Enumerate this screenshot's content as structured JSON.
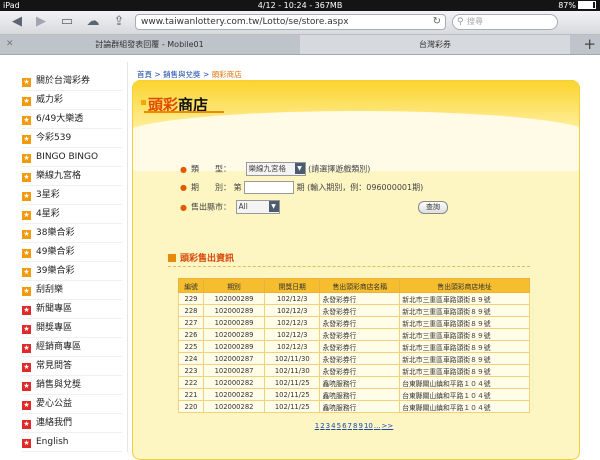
{
  "status": {
    "device": "iPad",
    "time": "4/12 - 10:24 - 367MB",
    "battery": "87%"
  },
  "browser": {
    "url": "www.taiwanlottery.com.tw/Lotto/se/store.aspx",
    "search_placeholder": "搜尋",
    "tabs": [
      "討論群組發表回覆 - Mobile01",
      "台灣彩券"
    ]
  },
  "sidebar": {
    "items": [
      {
        "label": "關於台灣彩券",
        "color": "orange"
      },
      {
        "label": "威力彩",
        "color": "orange"
      },
      {
        "label": "6/49大樂透",
        "color": "orange"
      },
      {
        "label": "今彩539",
        "color": "orange"
      },
      {
        "label": "BINGO BINGO",
        "color": "orange"
      },
      {
        "label": "樂線九宮格",
        "color": "orange"
      },
      {
        "label": "3星彩",
        "color": "orange"
      },
      {
        "label": "4星彩",
        "color": "orange"
      },
      {
        "label": "38樂合彩",
        "color": "orange"
      },
      {
        "label": "49樂合彩",
        "color": "orange"
      },
      {
        "label": "39樂合彩",
        "color": "orange"
      },
      {
        "label": "刮刮樂",
        "color": "orange"
      },
      {
        "label": "新聞專區",
        "color": "red"
      },
      {
        "label": "開獎專區",
        "color": "red"
      },
      {
        "label": "經銷商專區",
        "color": "red"
      },
      {
        "label": "常見問答",
        "color": "red"
      },
      {
        "label": "銷售與兌獎",
        "color": "red"
      },
      {
        "label": "愛心公益",
        "color": "red"
      },
      {
        "label": "連絡我們",
        "color": "red"
      },
      {
        "label": "English",
        "color": "red"
      }
    ]
  },
  "breadcrumb": {
    "home": "首頁",
    "sep": " > ",
    "parent": "銷售與兌獎",
    "current": "頭彩商店"
  },
  "page": {
    "title_highlight": "頭彩",
    "title_rest": "商店"
  },
  "form": {
    "type_label": "類　　型：",
    "type_value": "樂線九宮格",
    "type_hint": "(請選擇遊戲類別)",
    "period_label": "期　　別：",
    "period_prefix": "第",
    "period_suffix": "期 (輸入期別，例：096000001期)",
    "city_label": "售出縣市：",
    "city_value": "All",
    "query_button": "查詢"
  },
  "section": {
    "title": "頭彩售出資訊"
  },
  "table": {
    "headers": [
      "編號",
      "期別",
      "開獎日期",
      "售出頭彩商店名稱",
      "售出頭彩商店地址"
    ],
    "rows": [
      [
        "229",
        "102000289",
        "102/12/3",
        "永發彩券行",
        "新北市三重區車路頭街８９號"
      ],
      [
        "228",
        "102000289",
        "102/12/3",
        "永發彩券行",
        "新北市三重區車路頭街８９號"
      ],
      [
        "227",
        "102000289",
        "102/12/3",
        "永發彩券行",
        "新北市三重區車路頭街８９號"
      ],
      [
        "226",
        "102000289",
        "102/12/3",
        "永發彩券行",
        "新北市三重區車路頭街８９號"
      ],
      [
        "225",
        "102000289",
        "102/12/3",
        "永發彩券行",
        "新北市三重區車路頭街８９號"
      ],
      [
        "224",
        "102000287",
        "102/11/30",
        "永發彩券行",
        "新北市三重區車路頭街８９號"
      ],
      [
        "223",
        "102000287",
        "102/11/30",
        "永發彩券行",
        "新北市三重區車路頭街８９號"
      ],
      [
        "222",
        "102000282",
        "102/11/25",
        "鑫喨服務行",
        "台東縣關山鎮和平路１０４號"
      ],
      [
        "221",
        "102000282",
        "102/11/25",
        "鑫喨服務行",
        "台東縣關山鎮和平路１０４號"
      ],
      [
        "220",
        "102000282",
        "102/11/25",
        "鑫喨服務行",
        "台東縣關山鎮和平路１０４號"
      ]
    ]
  },
  "pager": {
    "pages": [
      "1",
      "2",
      "3",
      "4",
      "5",
      "6",
      "7",
      "8",
      "9",
      "10",
      "...",
      ">>"
    ]
  }
}
